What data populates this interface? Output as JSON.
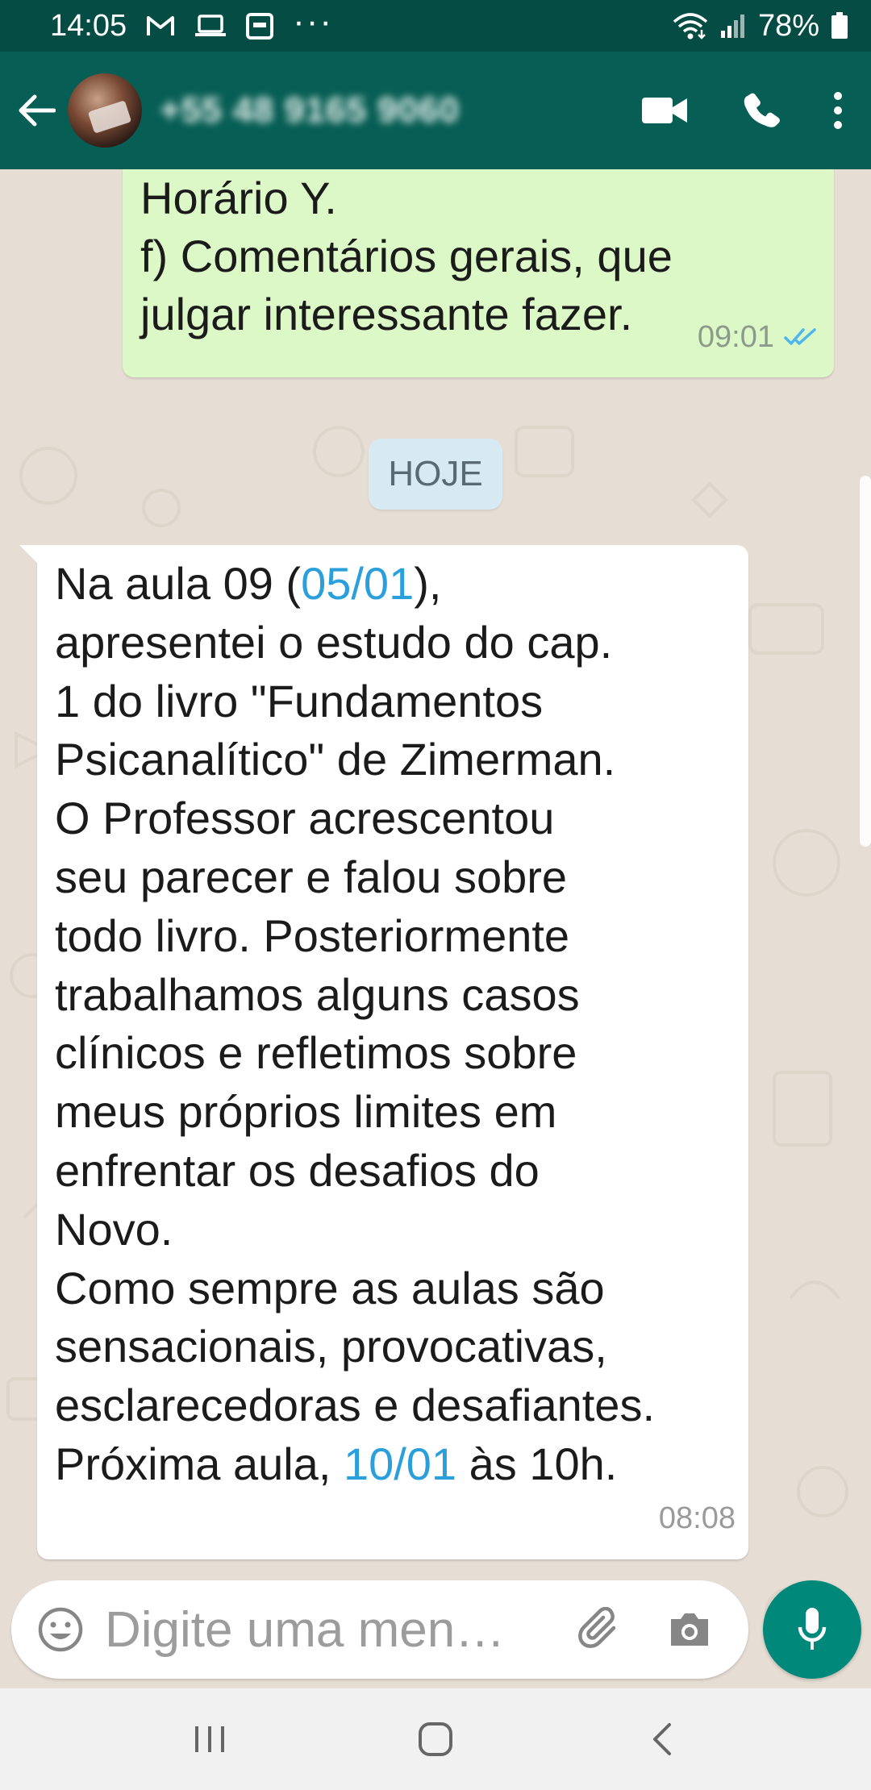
{
  "status_bar": {
    "time": "14:05",
    "dots": "···",
    "battery": "78%"
  },
  "header": {
    "contact_name": "+55 48 9165 9060",
    "icons": [
      "back-arrow-icon",
      "video-call-icon",
      "phone-call-icon",
      "more-options-icon"
    ]
  },
  "messages": {
    "outgoing": {
      "lines": [
        "Horário Y.",
        "f) Comentários gerais, que",
        "julgar interessante fazer."
      ],
      "time": "09:01",
      "status": "read"
    },
    "date_separator": "HOJE",
    "incoming": {
      "line1_pre": "Na aula 09 (",
      "line1_link": "05/01",
      "line1_post": "),",
      "lines": [
        "apresentei o estudo do cap.",
        "1 do livro \"Fundamentos",
        "Psicanalítico\" de Zimerman.",
        "O Professor acrescentou",
        "seu parecer e falou sobre",
        "todo livro. Posteriormente",
        "trabalhamos alguns casos",
        "clínicos e refletimos sobre",
        "meus próprios limites em",
        "enfrentar os desafios do",
        "Novo.",
        "Como sempre as aulas são",
        "sensacionais, provocativas,",
        "esclarecedoras e desafiantes."
      ],
      "last_pre": "Próxima aula, ",
      "last_link": "10/01",
      "last_post": " às 10h.",
      "time": "08:08"
    }
  },
  "composer": {
    "placeholder": "Digite uma men…"
  },
  "colors": {
    "header": "#075e54",
    "status_bar": "#054d44",
    "outgoing_bubble": "#dcf8c6",
    "incoming_bubble": "#ffffff",
    "link": "#2a9fdb",
    "mic_button": "#00897b",
    "read_ticks": "#4fb6ec"
  }
}
